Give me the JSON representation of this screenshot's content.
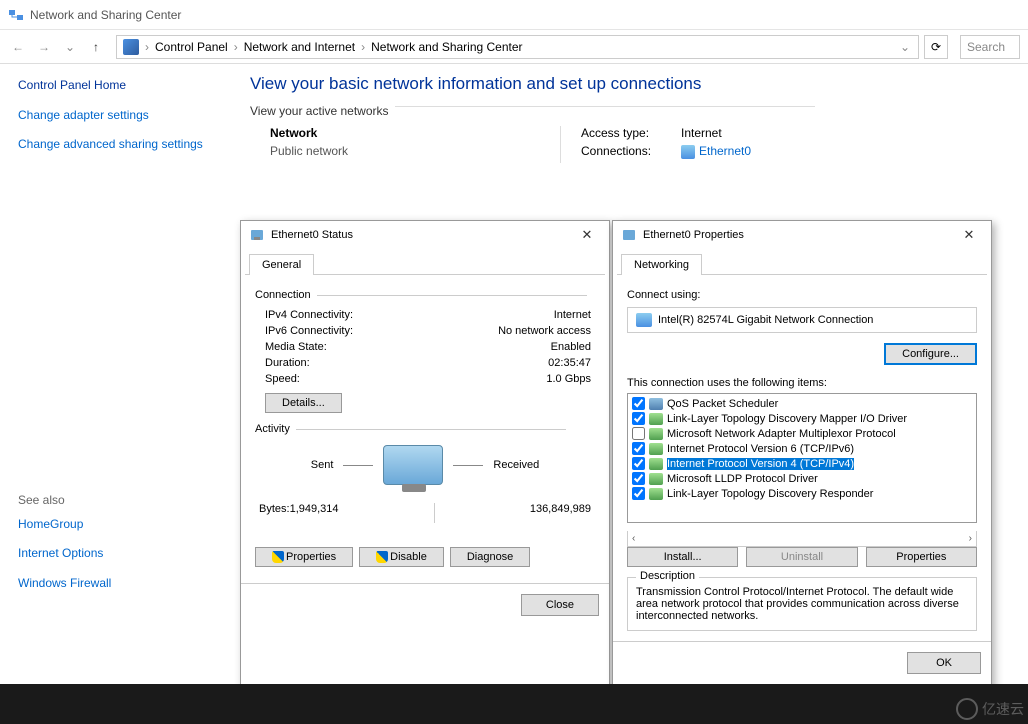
{
  "window": {
    "title": "Network and Sharing Center"
  },
  "breadcrumb": {
    "items": [
      "Control Panel",
      "Network and Internet",
      "Network and Sharing Center"
    ],
    "search_placeholder": "Search"
  },
  "sidebar": {
    "links": [
      "Control Panel Home",
      "Change adapter settings",
      "Change advanced sharing settings"
    ],
    "see_also_label": "See also",
    "see_also": [
      "HomeGroup",
      "Internet Options",
      "Windows Firewall"
    ]
  },
  "page": {
    "title": "View your basic network information and set up connections",
    "active_networks_label": "View your active networks",
    "network_name": "Network",
    "network_type": "Public network",
    "access_type_label": "Access type:",
    "access_type_value": "Internet",
    "connections_label": "Connections:",
    "connection_name": "Ethernet0"
  },
  "status_dialog": {
    "title": "Ethernet0 Status",
    "tab": "General",
    "connection_label": "Connection",
    "rows": {
      "ipv4_label": "IPv4 Connectivity:",
      "ipv4_value": "Internet",
      "ipv6_label": "IPv6 Connectivity:",
      "ipv6_value": "No network access",
      "media_label": "Media State:",
      "media_value": "Enabled",
      "duration_label": "Duration:",
      "duration_value": "02:35:47",
      "speed_label": "Speed:",
      "speed_value": "1.0 Gbps"
    },
    "details_btn": "Details...",
    "activity_label": "Activity",
    "sent_label": "Sent",
    "received_label": "Received",
    "bytes_label": "Bytes:",
    "bytes_sent": "1,949,314",
    "bytes_received": "136,849,989",
    "properties_btn": "Properties",
    "disable_btn": "Disable",
    "diagnose_btn": "Diagnose",
    "close_btn": "Close"
  },
  "props_dialog": {
    "title": "Ethernet0 Properties",
    "tab": "Networking",
    "connect_using_label": "Connect using:",
    "adapter": "Intel(R) 82574L Gigabit Network Connection",
    "configure_btn": "Configure...",
    "items_label": "This connection uses the following items:",
    "items": [
      {
        "checked": true,
        "icon": "sched",
        "label": "QoS Packet Scheduler"
      },
      {
        "checked": true,
        "icon": "proto",
        "label": "Link-Layer Topology Discovery Mapper I/O Driver"
      },
      {
        "checked": false,
        "icon": "proto",
        "label": "Microsoft Network Adapter Multiplexor Protocol"
      },
      {
        "checked": true,
        "icon": "proto",
        "label": "Internet Protocol Version 6 (TCP/IPv6)"
      },
      {
        "checked": true,
        "icon": "proto",
        "label": "Internet Protocol Version 4 (TCP/IPv4)",
        "selected": true
      },
      {
        "checked": true,
        "icon": "proto",
        "label": "Microsoft LLDP Protocol Driver"
      },
      {
        "checked": true,
        "icon": "proto",
        "label": "Link-Layer Topology Discovery Responder"
      }
    ],
    "install_btn": "Install...",
    "uninstall_btn": "Uninstall",
    "properties_btn": "Properties",
    "desc_label": "Description",
    "desc_text": "Transmission Control Protocol/Internet Protocol. The default wide area network protocol that provides communication across diverse interconnected networks.",
    "ok_btn": "OK"
  },
  "watermark": "亿速云"
}
